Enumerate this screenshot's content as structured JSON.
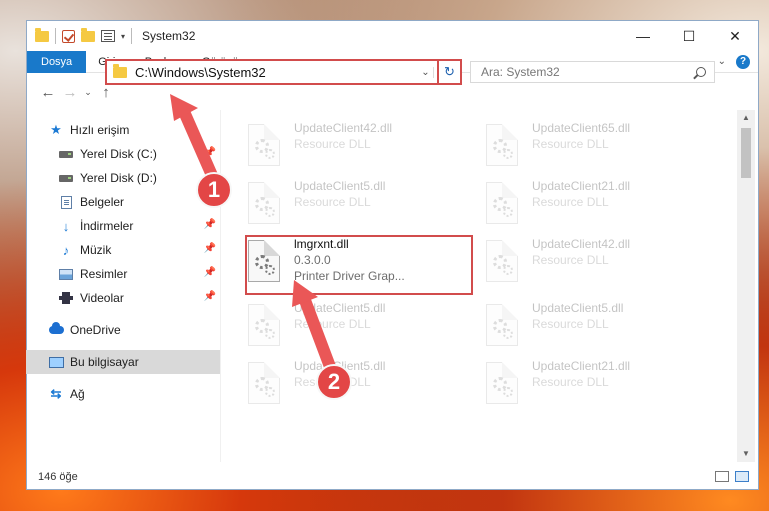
{
  "window": {
    "title": "System32",
    "controls": {
      "minimize": "—",
      "maximize": "☐",
      "close": "✕"
    }
  },
  "ribbon": {
    "tabs": [
      "Dosya",
      "Giriş",
      "Paylaş",
      "Görünüm"
    ]
  },
  "navbar": {
    "back": "←",
    "forward": "→",
    "recent": "⌄",
    "up": "↑",
    "address": "C:\\Windows\\System32",
    "refresh": "↻",
    "search_placeholder": "Ara: System32"
  },
  "sidebar": {
    "quick_access": "Hızlı erişim",
    "items": [
      {
        "label": "Yerel Disk (C:)",
        "icon": "disk-icon",
        "pinned": true
      },
      {
        "label": "Yerel Disk (D:)",
        "icon": "disk-icon",
        "pinned": false
      },
      {
        "label": "Belgeler",
        "icon": "document-icon",
        "pinned": true
      },
      {
        "label": "İndirmeler",
        "icon": "download-icon",
        "pinned": true
      },
      {
        "label": "Müzik",
        "icon": "music-icon",
        "pinned": true
      },
      {
        "label": "Resimler",
        "icon": "pictures-icon",
        "pinned": true
      },
      {
        "label": "Videolar",
        "icon": "video-icon",
        "pinned": true
      }
    ],
    "onedrive": "OneDrive",
    "this_pc": "Bu bilgisayar",
    "network": "Ağ"
  },
  "files": {
    "col1": [
      {
        "name": "UpdateClient42.dll",
        "sub": "Resource DLL"
      },
      {
        "name": "UpdateClient5.dll",
        "sub": "Resource DLL"
      },
      {
        "name": "lmgrxnt.dll",
        "sub": "0.3.0.0",
        "sub2": "Printer Driver Grap..."
      },
      {
        "name": "UpdateClient5.dll",
        "sub": "Resource DLL"
      },
      {
        "name": "UpdateClient5.dll",
        "sub": "Resource DLL"
      }
    ],
    "col2": [
      {
        "name": "UpdateClient65.dll",
        "sub": "Resource DLL"
      },
      {
        "name": "UpdateClient21.dll",
        "sub": "Resource DLL"
      },
      {
        "name": "UpdateClient42.dll",
        "sub": "Resource DLL"
      },
      {
        "name": "UpdateClient5.dll",
        "sub": "Resource DLL"
      },
      {
        "name": "UpdateClient21.dll",
        "sub": "Resource DLL"
      }
    ]
  },
  "status": {
    "count": "146 öğe"
  },
  "callouts": {
    "one": "1",
    "two": "2"
  },
  "colors": {
    "accent": "#1979ca",
    "highlight": "#d24c4c",
    "callout": "#e34646"
  }
}
